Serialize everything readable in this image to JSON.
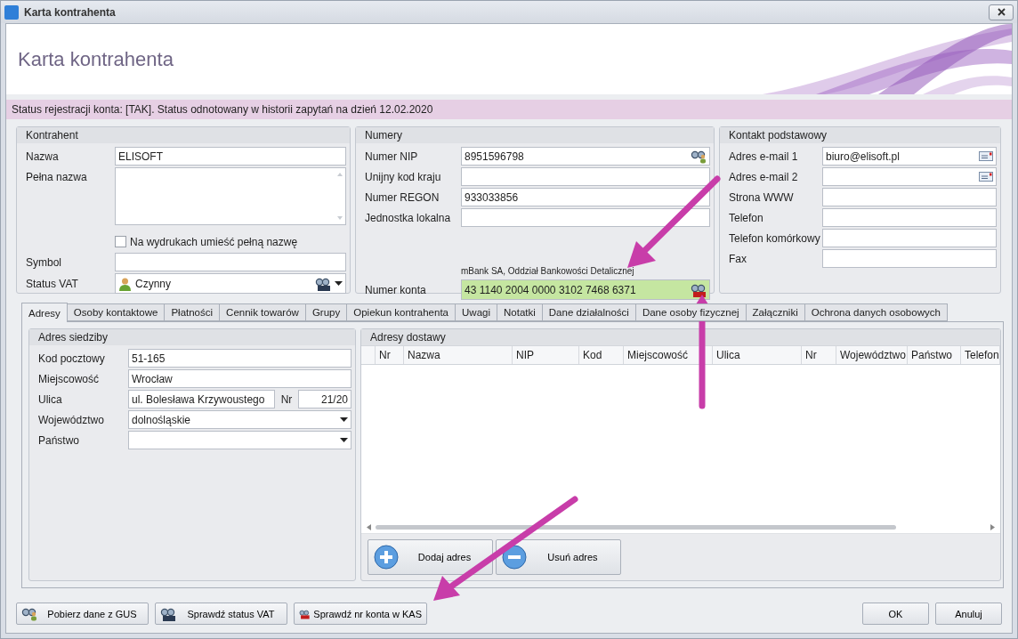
{
  "window": {
    "title": "Karta kontrahenta"
  },
  "header": {
    "title": "Karta kontrahenta"
  },
  "status_message": "Status rejestracji konta: [TAK]. Status odnotowany w historii zapytań na dzień 12.02.2020",
  "kontrahent": {
    "title": "Kontrahent",
    "rows": [
      {
        "kind": "input",
        "label": "Nazwa",
        "value": "ELISOFT"
      },
      {
        "kind": "textarea",
        "label": "Pełna nazwa"
      },
      {
        "kind": "checkbox",
        "label": "Na wydrukach umieść pełną nazwę",
        "checked": false
      },
      {
        "kind": "input",
        "label": "Symbol"
      },
      {
        "kind": "vat",
        "label": "Status VAT",
        "value": "Czynny"
      }
    ]
  },
  "numery": {
    "title": "Numery",
    "rows": [
      {
        "kind": "lookup",
        "label": "Numer NIP",
        "value": "8951596798"
      },
      {
        "kind": "input",
        "label": "Unijny kod kraju"
      },
      {
        "kind": "input",
        "label": "Numer REGON",
        "value": "933033856"
      },
      {
        "kind": "input",
        "label": "Jednostka lokalna"
      },
      {
        "kind": "account",
        "label": "Numer konta",
        "value": "43 1140 2004 0000 3102 7468 6371",
        "note": "mBank SA, Oddział Bankowości Detalicznej"
      }
    ]
  },
  "kontakt": {
    "title": "Kontakt podstawowy",
    "rows": [
      {
        "kind": "email",
        "label": "Adres e-mail 1",
        "value": "biuro@elisoft.pl"
      },
      {
        "kind": "email",
        "label": "Adres e-mail 2"
      },
      {
        "kind": "input",
        "label": "Strona WWW"
      },
      {
        "kind": "input",
        "label": "Telefon"
      },
      {
        "kind": "input",
        "label": "Telefon komórkowy"
      },
      {
        "kind": "input",
        "label": "Fax"
      }
    ]
  },
  "tabs": [
    {
      "label": "Adresy",
      "selected": true
    },
    {
      "label": "Osoby kontaktowe",
      "selected": false
    },
    {
      "label": "Płatności",
      "selected": false
    },
    {
      "label": "Cennik towarów",
      "selected": false
    },
    {
      "label": "Grupy",
      "selected": false
    },
    {
      "label": "Opiekun kontrahenta",
      "selected": false
    },
    {
      "label": "Uwagi",
      "selected": false
    },
    {
      "label": "Notatki",
      "selected": false
    },
    {
      "label": "Dane działalności",
      "selected": false
    },
    {
      "label": "Dane osoby fizycznej",
      "selected": false
    },
    {
      "label": "Załączniki",
      "selected": false
    },
    {
      "label": "Ochrona danych osobowych",
      "selected": false
    }
  ],
  "adres_siedziby": {
    "title": "Adres siedziby",
    "rows": [
      {
        "kind": "input",
        "label": "Kod pocztowy",
        "value": "51-165"
      },
      {
        "kind": "input",
        "label": "Miejscowość",
        "value": "Wrocław"
      },
      {
        "kind": "street",
        "label": "Ulica",
        "value": "ul. Bolesława Krzywoustego",
        "nr_label": "Nr",
        "nr_value": "21/20"
      },
      {
        "kind": "select",
        "label": "Województwo",
        "value": "dolnośląskie"
      },
      {
        "kind": "select",
        "label": "Państwo"
      }
    ]
  },
  "adresy_dostawy": {
    "title": "Adresy dostawy",
    "columns": [
      "Nr",
      "Nazwa",
      "NIP",
      "Kod",
      "Miejscowość",
      "Ulica",
      "Nr",
      "Województwo",
      "Państwo",
      "Telefon"
    ],
    "buttons": [
      {
        "kind": "add",
        "label": "Dodaj adres"
      },
      {
        "kind": "remove",
        "label": "Usuń adres"
      }
    ]
  },
  "footer": {
    "left": [
      {
        "kind": "gus",
        "label": "Pobierz dane z GUS"
      },
      {
        "kind": "vat",
        "label": "Sprawdź status VAT"
      },
      {
        "kind": "kas",
        "label": "Sprawdź nr konta w KAS"
      }
    ],
    "right": [
      "OK",
      "Anuluj"
    ]
  }
}
